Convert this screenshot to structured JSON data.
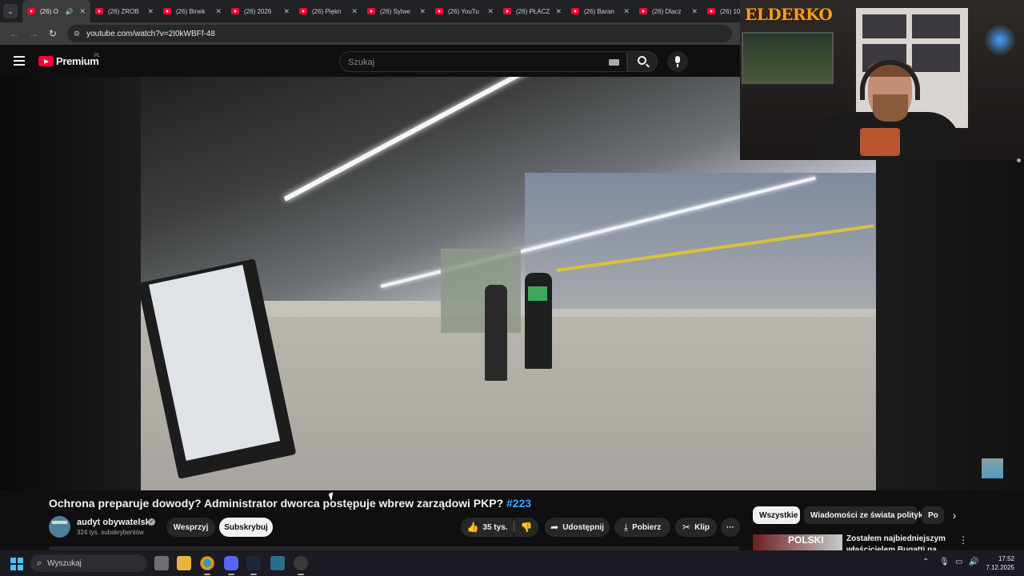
{
  "browser": {
    "tabs": [
      {
        "label": "(26) O",
        "active": true,
        "audio": true
      },
      {
        "label": "(26) ZROB",
        "active": false
      },
      {
        "label": "(26) Binek",
        "active": false
      },
      {
        "label": "(26) 2026",
        "active": false
      },
      {
        "label": "(26) Piękn",
        "active": false
      },
      {
        "label": "(26) Sylwe",
        "active": false
      },
      {
        "label": "(26) YouTu",
        "active": false
      },
      {
        "label": "(26) PŁACZ",
        "active": false
      },
      {
        "label": "(26) Baran",
        "active": false
      },
      {
        "label": "(26) Dlacz",
        "active": false
      },
      {
        "label": "(26) 10",
        "active": false
      }
    ],
    "tab_menu_icon": "chevron-down",
    "url": "youtube.com/watch?v=2I0kWBFf-48"
  },
  "youtube": {
    "brand": "Premium",
    "country": "PL",
    "search_placeholder": "Szukaj"
  },
  "webcam": {
    "overlay_text": "ELDERKO"
  },
  "video": {
    "title": "Ochrona preparuje dowody? Administrator dworca postępuje wbrew zarządowi PKP? ",
    "hashtag": "#223",
    "channel_name": "audyt obywatelski",
    "subscribers": "324 tys. subskrybentów",
    "support_label": "Wesprzyj",
    "subscribe_label": "Subskrybuj",
    "likes": "35 tys.",
    "share_label": "Udostępnij",
    "download_label": "Pobierz",
    "clip_label": "Klip",
    "more_label": "···"
  },
  "sidebar": {
    "chips": [
      "Wszystkie",
      "Wiadomości ze świata polityki",
      "Po"
    ],
    "recommendation": {
      "thumb_text": "POLSKI",
      "title": "Zostałem najbiedniejszym właścicielem Bugatti na świecie"
    }
  },
  "taskbar": {
    "search_label": "Wyszukaj",
    "time": "17:52",
    "date": "7.12.2025",
    "colors": {
      "accent": "#4cc2ff"
    }
  }
}
